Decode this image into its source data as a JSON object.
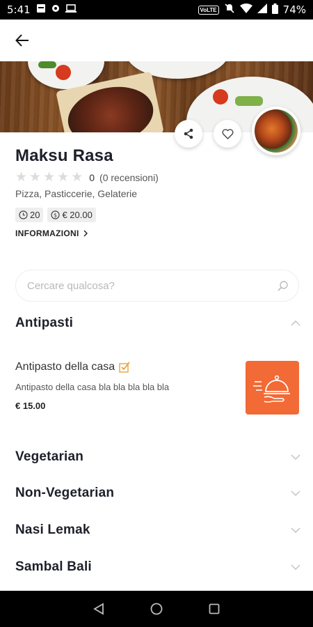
{
  "status_bar": {
    "time": "5:41",
    "network_label": "VoLTE",
    "battery": "74%"
  },
  "app_bar": {
    "back_icon": "arrow-left-icon"
  },
  "restaurant": {
    "name": "Maksu Rasa",
    "rating": {
      "value": "0",
      "reviews": "(0 recensioni)",
      "stars_filled": 0,
      "stars_total": 5
    },
    "categories": "Pizza, Pasticcerie, Gelaterie",
    "delivery_time": "20",
    "min_order": "€ 20.00",
    "info_label": "INFORMAZIONI"
  },
  "search": {
    "placeholder": "Cercare qualcosa?"
  },
  "sections": [
    {
      "title": "Antipasti",
      "expanded": true,
      "items": [
        {
          "name": "Antipasto della casa",
          "description": "Antipasto della casa bla bla bla bla bla",
          "price": "€ 15.00"
        }
      ]
    },
    {
      "title": "Vegetarian",
      "expanded": false
    },
    {
      "title": "Non-Vegetarian",
      "expanded": false
    },
    {
      "title": "Nasi Lemak",
      "expanded": false
    },
    {
      "title": "Sambal Bali",
      "expanded": false
    }
  ],
  "colors": {
    "accent": "#f26a35",
    "check": "#e9a23b"
  }
}
